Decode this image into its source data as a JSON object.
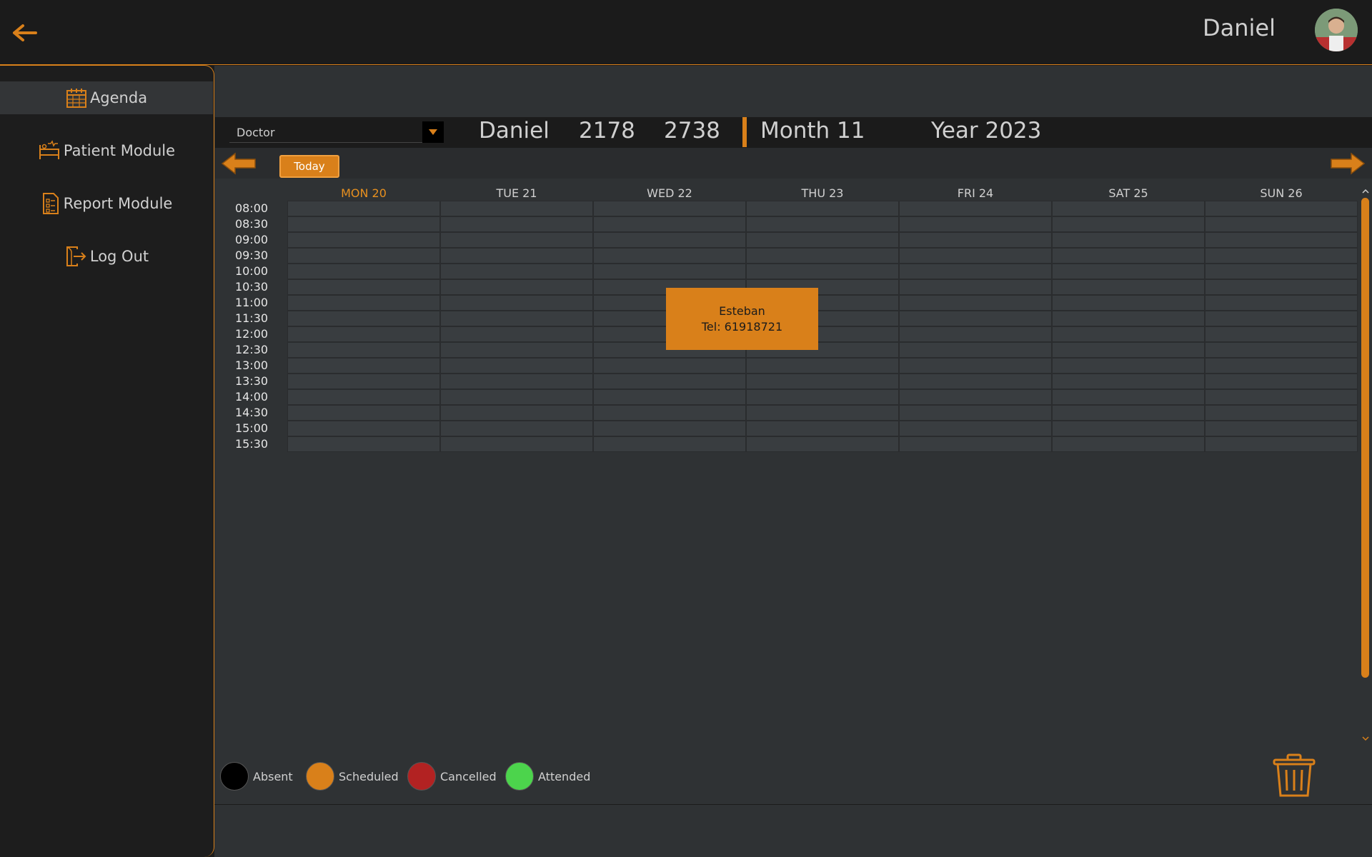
{
  "user": {
    "name": "Daniel"
  },
  "sidebar": {
    "items": [
      {
        "label": "Agenda",
        "icon": "calendar-icon",
        "active": true
      },
      {
        "label": "Patient Module",
        "icon": "bed-icon"
      },
      {
        "label": "Report Module",
        "icon": "report-icon"
      },
      {
        "label": "Log Out",
        "icon": "logout-icon"
      }
    ]
  },
  "header": {
    "select_value": "Doctor",
    "doctor_name": "Daniel",
    "code1": "2178",
    "code2": "2738",
    "month": "Month 11",
    "year": "Year 2023"
  },
  "toolbar": {
    "today_label": "Today"
  },
  "calendar": {
    "days": [
      "MON 20",
      "TUE 21",
      "WED 22",
      "THU 23",
      "FRI 24",
      "SAT 25",
      "SUN 26"
    ],
    "today_index": 0,
    "times": [
      "08:00",
      "08:30",
      "09:00",
      "09:30",
      "10:00",
      "10:30",
      "11:00",
      "11:30",
      "12:00",
      "12:30",
      "13:00",
      "13:30",
      "14:00",
      "14:30",
      "15:00",
      "15:30"
    ],
    "appointment": {
      "name": "Esteban",
      "phone": "Tel: 61918721",
      "day": "WED 22",
      "start": "10:00",
      "end": "11:30",
      "status": "Scheduled"
    }
  },
  "legend": [
    {
      "label": "Absent",
      "color": "#000000"
    },
    {
      "label": "Scheduled",
      "color": "#d9801a"
    },
    {
      "label": "Cancelled",
      "color": "#b22222"
    },
    {
      "label": "Attended",
      "color": "#4cd44c"
    }
  ],
  "colors": {
    "accent": "#d9801a"
  }
}
